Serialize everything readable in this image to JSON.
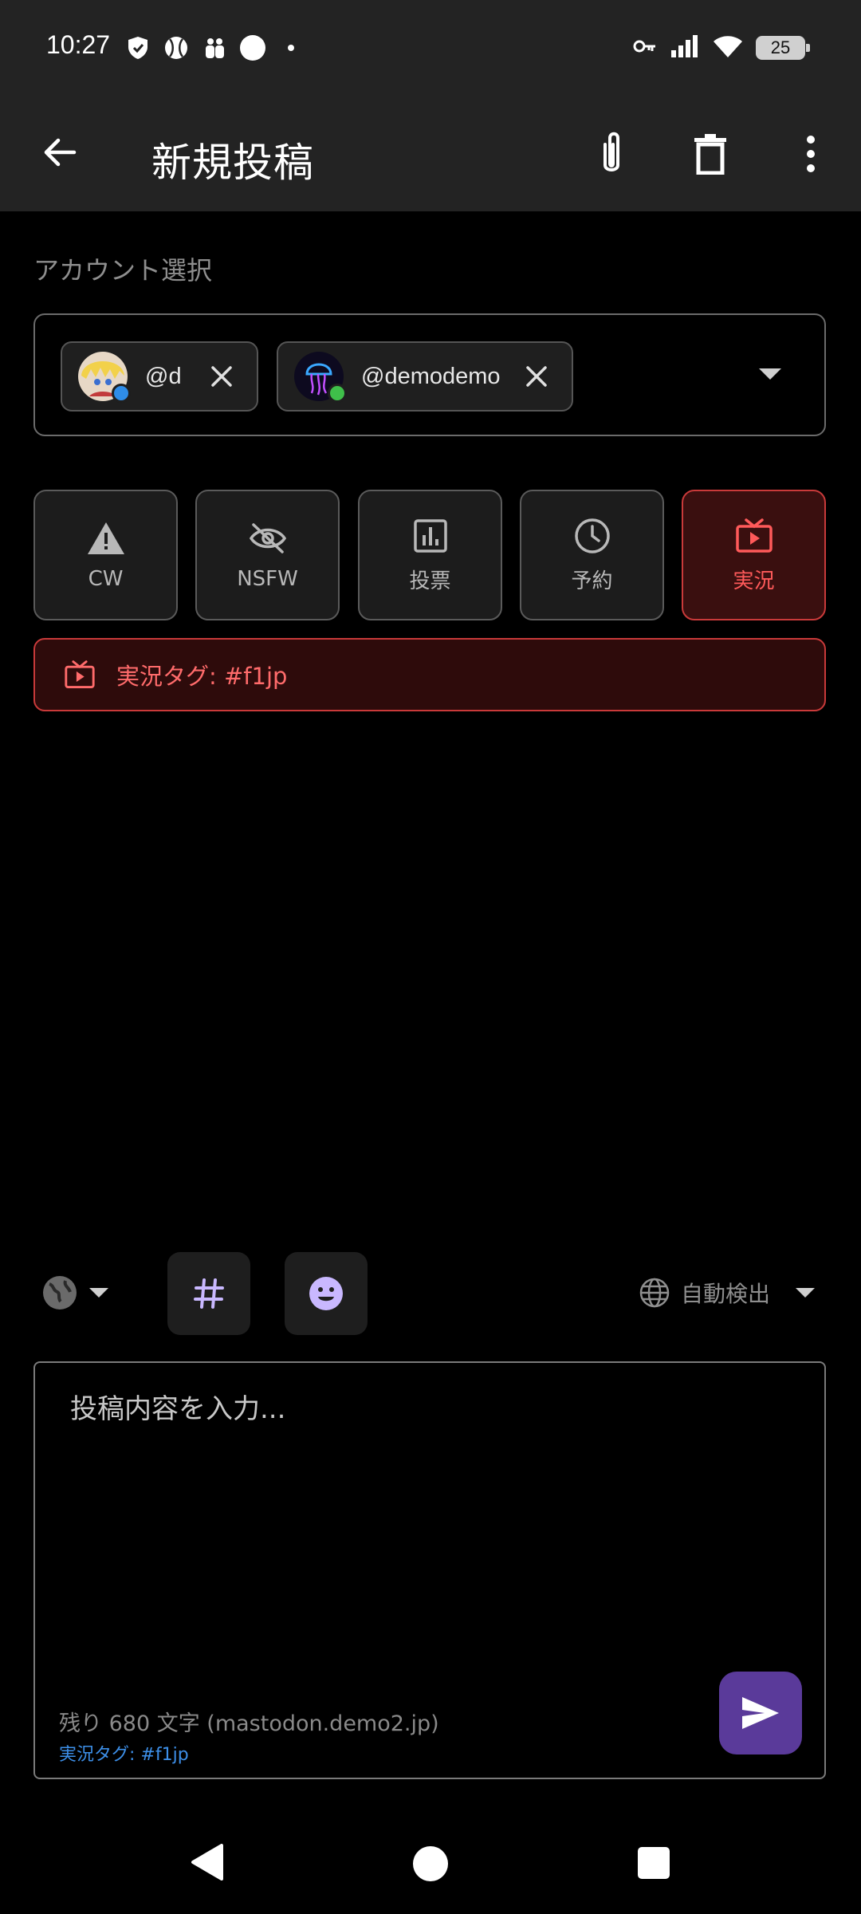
{
  "status_bar": {
    "time": "10:27",
    "battery": "25",
    "left_icons": [
      "shield-icon",
      "baseball-icon",
      "two-person-icon",
      "circle-icon",
      "dot-icon"
    ],
    "right_icons": [
      "key-icon",
      "signal-icon",
      "wifi-icon",
      "battery-icon"
    ]
  },
  "app_bar": {
    "title": "新規投稿",
    "actions": [
      "attach-icon",
      "delete-icon",
      "more-vert-icon"
    ]
  },
  "account_select": {
    "label": "アカウント選択",
    "chips": [
      {
        "handle": "@d",
        "status_color": "#2f8de8"
      },
      {
        "handle": "@demodemo",
        "status_color": "#3fbf4a"
      }
    ]
  },
  "options": [
    {
      "label": "CW",
      "icon": "warning-icon",
      "active": false
    },
    {
      "label": "NSFW",
      "icon": "eye-off-icon",
      "active": false
    },
    {
      "label": "投票",
      "icon": "poll-icon",
      "active": false
    },
    {
      "label": "予約",
      "icon": "clock-icon",
      "active": false
    },
    {
      "label": "実況",
      "icon": "tv-icon",
      "active": true
    }
  ],
  "live_tag_banner": "実況タグ: #f1jp",
  "toolbar": {
    "visibility_icon": "globe-icon",
    "hashtag_icon": "hashtag-icon",
    "emoji_icon": "emoji-icon",
    "language": "自動検出"
  },
  "compose": {
    "placeholder": "投稿内容を入力...",
    "counter": "残り 680 文字 (mastodon.demo2.jp)",
    "live_tag": "実況タグ: #f1jp"
  },
  "colors": {
    "accent_red": "#ff5a5a",
    "send_button": "#5a3a9a",
    "tool_icon": "#c9b8ff",
    "link_blue": "#3d8fe8"
  }
}
